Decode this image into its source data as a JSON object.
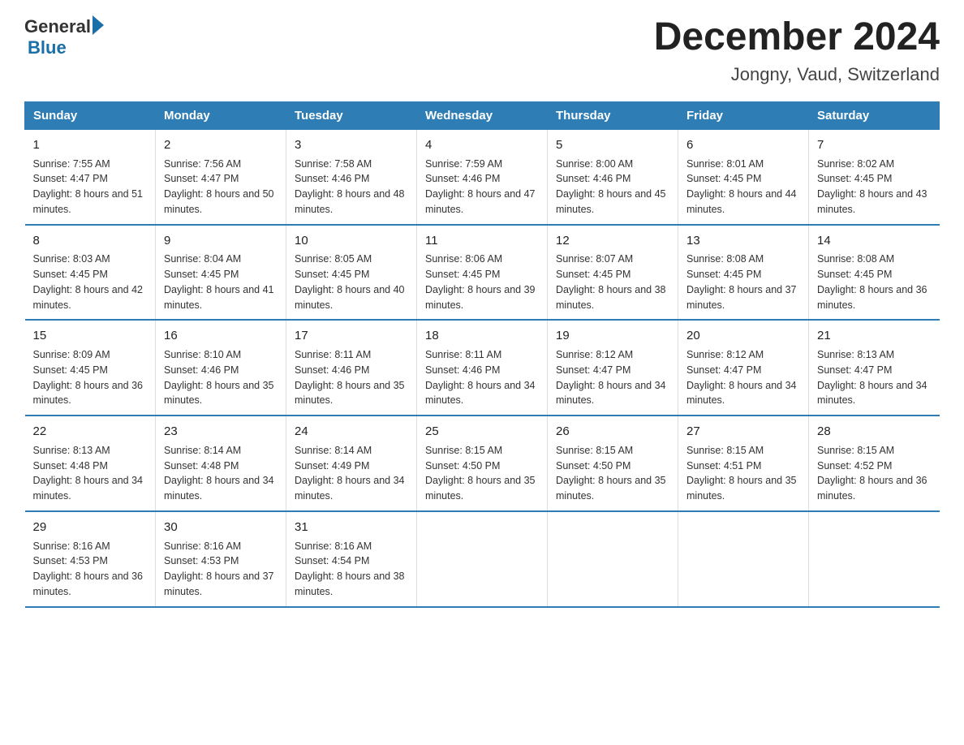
{
  "logo": {
    "general": "General",
    "blue": "Blue"
  },
  "title": "December 2024",
  "subtitle": "Jongny, Vaud, Switzerland",
  "headers": [
    "Sunday",
    "Monday",
    "Tuesday",
    "Wednesday",
    "Thursday",
    "Friday",
    "Saturday"
  ],
  "weeks": [
    [
      {
        "day": "1",
        "sunrise": "7:55 AM",
        "sunset": "4:47 PM",
        "daylight": "8 hours and 51 minutes."
      },
      {
        "day": "2",
        "sunrise": "7:56 AM",
        "sunset": "4:47 PM",
        "daylight": "8 hours and 50 minutes."
      },
      {
        "day": "3",
        "sunrise": "7:58 AM",
        "sunset": "4:46 PM",
        "daylight": "8 hours and 48 minutes."
      },
      {
        "day": "4",
        "sunrise": "7:59 AM",
        "sunset": "4:46 PM",
        "daylight": "8 hours and 47 minutes."
      },
      {
        "day": "5",
        "sunrise": "8:00 AM",
        "sunset": "4:46 PM",
        "daylight": "8 hours and 45 minutes."
      },
      {
        "day": "6",
        "sunrise": "8:01 AM",
        "sunset": "4:45 PM",
        "daylight": "8 hours and 44 minutes."
      },
      {
        "day": "7",
        "sunrise": "8:02 AM",
        "sunset": "4:45 PM",
        "daylight": "8 hours and 43 minutes."
      }
    ],
    [
      {
        "day": "8",
        "sunrise": "8:03 AM",
        "sunset": "4:45 PM",
        "daylight": "8 hours and 42 minutes."
      },
      {
        "day": "9",
        "sunrise": "8:04 AM",
        "sunset": "4:45 PM",
        "daylight": "8 hours and 41 minutes."
      },
      {
        "day": "10",
        "sunrise": "8:05 AM",
        "sunset": "4:45 PM",
        "daylight": "8 hours and 40 minutes."
      },
      {
        "day": "11",
        "sunrise": "8:06 AM",
        "sunset": "4:45 PM",
        "daylight": "8 hours and 39 minutes."
      },
      {
        "day": "12",
        "sunrise": "8:07 AM",
        "sunset": "4:45 PM",
        "daylight": "8 hours and 38 minutes."
      },
      {
        "day": "13",
        "sunrise": "8:08 AM",
        "sunset": "4:45 PM",
        "daylight": "8 hours and 37 minutes."
      },
      {
        "day": "14",
        "sunrise": "8:08 AM",
        "sunset": "4:45 PM",
        "daylight": "8 hours and 36 minutes."
      }
    ],
    [
      {
        "day": "15",
        "sunrise": "8:09 AM",
        "sunset": "4:45 PM",
        "daylight": "8 hours and 36 minutes."
      },
      {
        "day": "16",
        "sunrise": "8:10 AM",
        "sunset": "4:46 PM",
        "daylight": "8 hours and 35 minutes."
      },
      {
        "day": "17",
        "sunrise": "8:11 AM",
        "sunset": "4:46 PM",
        "daylight": "8 hours and 35 minutes."
      },
      {
        "day": "18",
        "sunrise": "8:11 AM",
        "sunset": "4:46 PM",
        "daylight": "8 hours and 34 minutes."
      },
      {
        "day": "19",
        "sunrise": "8:12 AM",
        "sunset": "4:47 PM",
        "daylight": "8 hours and 34 minutes."
      },
      {
        "day": "20",
        "sunrise": "8:12 AM",
        "sunset": "4:47 PM",
        "daylight": "8 hours and 34 minutes."
      },
      {
        "day": "21",
        "sunrise": "8:13 AM",
        "sunset": "4:47 PM",
        "daylight": "8 hours and 34 minutes."
      }
    ],
    [
      {
        "day": "22",
        "sunrise": "8:13 AM",
        "sunset": "4:48 PM",
        "daylight": "8 hours and 34 minutes."
      },
      {
        "day": "23",
        "sunrise": "8:14 AM",
        "sunset": "4:48 PM",
        "daylight": "8 hours and 34 minutes."
      },
      {
        "day": "24",
        "sunrise": "8:14 AM",
        "sunset": "4:49 PM",
        "daylight": "8 hours and 34 minutes."
      },
      {
        "day": "25",
        "sunrise": "8:15 AM",
        "sunset": "4:50 PM",
        "daylight": "8 hours and 35 minutes."
      },
      {
        "day": "26",
        "sunrise": "8:15 AM",
        "sunset": "4:50 PM",
        "daylight": "8 hours and 35 minutes."
      },
      {
        "day": "27",
        "sunrise": "8:15 AM",
        "sunset": "4:51 PM",
        "daylight": "8 hours and 35 minutes."
      },
      {
        "day": "28",
        "sunrise": "8:15 AM",
        "sunset": "4:52 PM",
        "daylight": "8 hours and 36 minutes."
      }
    ],
    [
      {
        "day": "29",
        "sunrise": "8:16 AM",
        "sunset": "4:53 PM",
        "daylight": "8 hours and 36 minutes."
      },
      {
        "day": "30",
        "sunrise": "8:16 AM",
        "sunset": "4:53 PM",
        "daylight": "8 hours and 37 minutes."
      },
      {
        "day": "31",
        "sunrise": "8:16 AM",
        "sunset": "4:54 PM",
        "daylight": "8 hours and 38 minutes."
      },
      null,
      null,
      null,
      null
    ]
  ]
}
